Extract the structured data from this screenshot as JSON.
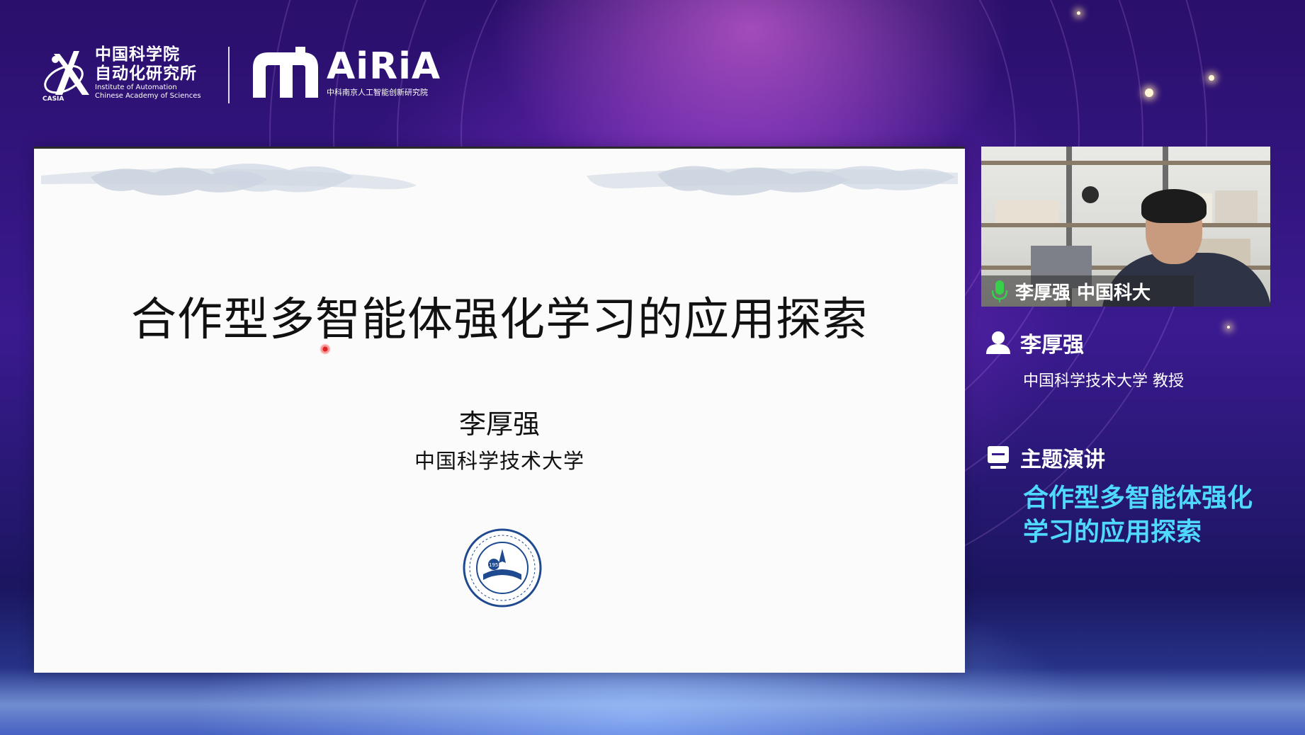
{
  "header": {
    "casia_name_line1": "中国科学院",
    "casia_name_line2": "自动化研究所",
    "casia_en_line1": "Institute of Automation",
    "casia_en_line2": "Chinese Academy of Sciences",
    "casia_mark_text": "CASIA",
    "airia_name": "AiRiA",
    "airia_subtitle": "中科南京人工智能创新研究院"
  },
  "slide": {
    "title": "合作型多智能体强化学习的应用探索",
    "author": "李厚强",
    "affiliation": "中国科学技术大学",
    "seal_year": "1958"
  },
  "webcam": {
    "name_label": "李厚强 中国科大"
  },
  "speaker": {
    "icon": "person-icon",
    "name": "李厚强",
    "affiliation": "中国科学技术大学  教授"
  },
  "topic": {
    "icon": "screen-icon",
    "label": "主题演讲",
    "title": "合作型多智能体强化学习的应用探索"
  },
  "colors": {
    "topic_title": "#4fd9ff",
    "background": "#3a1a8f",
    "mic": "#37d04a"
  }
}
